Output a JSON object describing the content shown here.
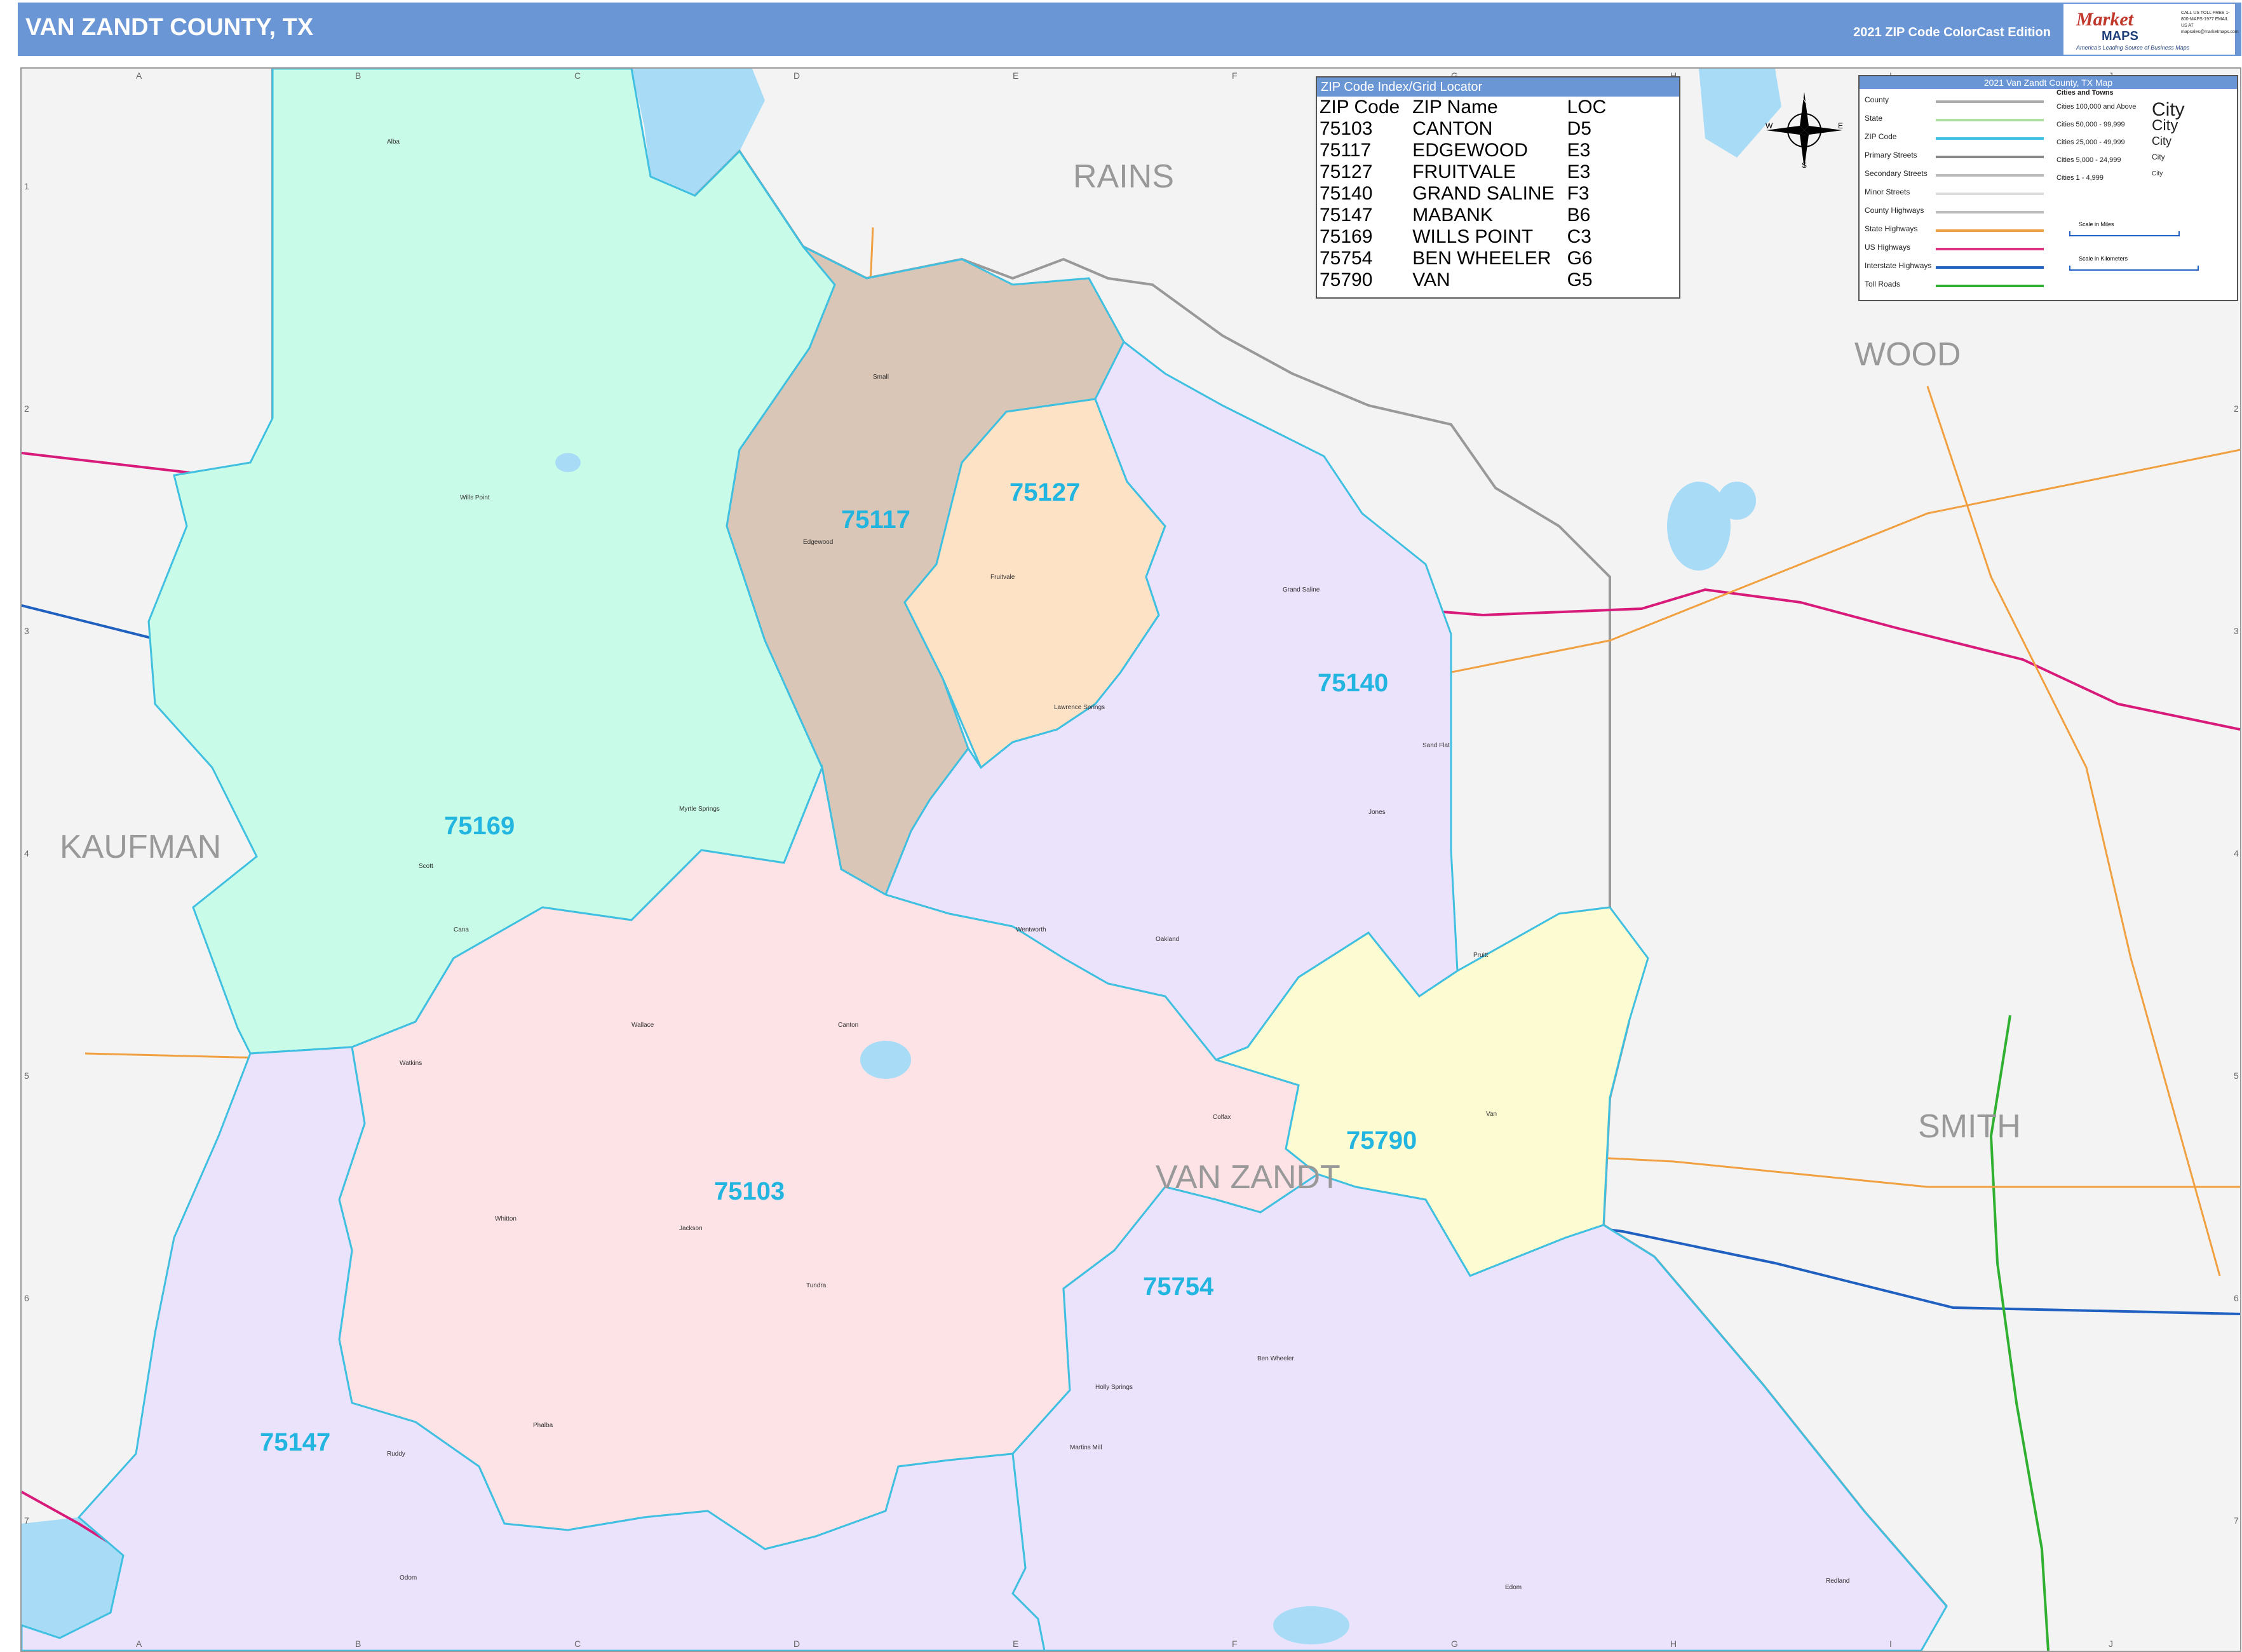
{
  "header": {
    "title": "VAN ZANDT COUNTY, TX",
    "edition": "2021 ZIP Code ColorCast Edition",
    "brand_top": "Market",
    "brand_bottom": "MAPS",
    "tagline": "America's Leading Source of Business Maps",
    "contact": "CALL US TOLL FREE 1-800-MAPS-1977 EMAIL US AT mapsales@marketmaps.com"
  },
  "zip_index": {
    "title": "ZIP Code Index/Grid Locator",
    "columns": [
      "ZIP Code",
      "ZIP Name",
      "LOC"
    ],
    "rows": [
      [
        "75103",
        "CANTON",
        "D5"
      ],
      [
        "75117",
        "EDGEWOOD",
        "E3"
      ],
      [
        "75127",
        "FRUITVALE",
        "E3"
      ],
      [
        "75140",
        "GRAND SALINE",
        "F3"
      ],
      [
        "75147",
        "MABANK",
        "B6"
      ],
      [
        "75169",
        "WILLS POINT",
        "C3"
      ],
      [
        "75754",
        "BEN WHEELER",
        "G6"
      ],
      [
        "75790",
        "VAN",
        "G5"
      ]
    ]
  },
  "legend": {
    "title": "2021 Van Zandt County, TX Map",
    "line_items": [
      "County",
      "State",
      "ZIP Code",
      "Primary Streets",
      "Secondary Streets",
      "Minor Streets",
      "County Highways",
      "State Highways",
      "US Highways",
      "Interstate Highways",
      "Toll Roads"
    ],
    "line_colors": [
      "#aaaaaa",
      "#b0e0a0",
      "#40c0e0",
      "#888888",
      "#bbbbbb",
      "#dddddd",
      "#bbbbbb",
      "#f0a040",
      "#e03080",
      "#2060c0",
      "#30b030"
    ],
    "cities_title": "Cities and Towns",
    "cities": [
      {
        "label": "Cities 100,000 and Above",
        "sample": "City"
      },
      {
        "label": "Cities 50,000 - 99,999",
        "sample": "City"
      },
      {
        "label": "Cities 25,000 - 49,999",
        "sample": "City"
      },
      {
        "label": "Cities 5,000 - 24,999",
        "sample": "City"
      },
      {
        "label": "Cities 1 - 4,999",
        "sample": "City"
      }
    ],
    "scale_miles": "Scale in Miles",
    "scale_km": "Scale in Kilometers"
  },
  "compass": {
    "n": "N",
    "s": "S",
    "e": "E",
    "w": "W"
  },
  "grid": {
    "columns": [
      "A",
      "B",
      "C",
      "D",
      "E",
      "F",
      "G",
      "H",
      "I",
      "J"
    ],
    "rows": [
      "1",
      "2",
      "3",
      "4",
      "5",
      "6",
      "7"
    ]
  },
  "counties": [
    "RAINS",
    "WOOD",
    "KAUFMAN",
    "SMITH",
    "VAN ZANDT"
  ],
  "zip_codes": [
    "75117",
    "75127",
    "75140",
    "75169",
    "75103",
    "75790",
    "75754",
    "75147"
  ],
  "zip_colors": {
    "75169": "#c8fbe8",
    "75117": "#d9c6b6",
    "75127": "#fde2c6",
    "75140": "#ebe2fb",
    "75103": "#fde2e6",
    "75790": "#fdfbd2",
    "75754": "#ebe2fb",
    "75147": "#ebe2fb"
  },
  "towns": [
    "Alba",
    "Wills Point",
    "Edgewood",
    "Fruitvale",
    "Grand Saline",
    "Lawrence Springs",
    "Sand Flat",
    "Jones",
    "Fruitvale",
    "Myrtle Springs",
    "Scott",
    "Cana",
    "Wentworth",
    "Oakland",
    "Canton",
    "Wallace",
    "Watkins",
    "Whitton",
    "Jackson",
    "Tundra",
    "Pruitt",
    "Van",
    "Colfax",
    "Ben Wheeler",
    "Holly Springs",
    "Martins Mill",
    "Phalba",
    "Ruddy",
    "Odom",
    "Edom",
    "Redland",
    "Small"
  ]
}
